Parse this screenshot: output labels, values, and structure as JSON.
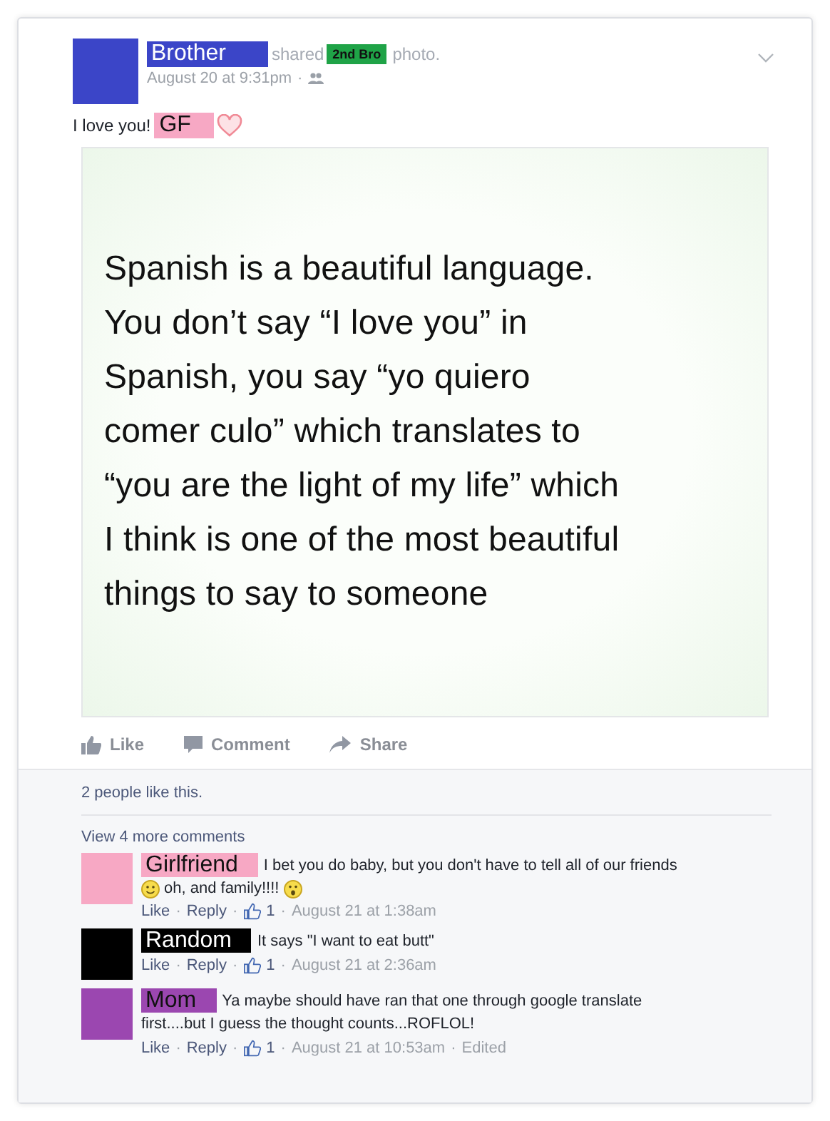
{
  "separator": "·",
  "post": {
    "author": {
      "name": "Brother",
      "color": "#3b45c8"
    },
    "shared_text": "shared",
    "source": {
      "name": "2nd Bro",
      "color": "#1fa347"
    },
    "object_text": "photo.",
    "time": "August 20 at 9:31pm",
    "message": "I love you!",
    "tag": {
      "name": "GF",
      "color": "#f7a8c4"
    },
    "image_lines": [
      "Spanish is a beautiful language.",
      "You don’t say “I love you” in",
      "Spanish, you say “yo quiero",
      "comer culo” which translates to",
      "“you are the light of my life” which",
      "I think is one of the most beautiful",
      "things to say to someone"
    ]
  },
  "actions": [
    "Like",
    "Comment",
    "Share"
  ],
  "likes_text": "2 people like this.",
  "view_more": "View 4 more comments",
  "comments": [
    {
      "name": "Girlfriend",
      "color": "#f7a8c4",
      "lines": [
        [
          {
            "kind": "text",
            "text": "I bet you do baby, but you don't have to tell all of our friends"
          }
        ],
        [
          {
            "kind": "smile"
          },
          {
            "kind": "text",
            "text": "oh, and family!!!!"
          },
          {
            "kind": "gasp"
          }
        ]
      ],
      "like": "Like",
      "reply": "Reply",
      "count": "1",
      "time": "August 21 at 1:38am"
    },
    {
      "name": "Random",
      "color": "#000000",
      "lines": [
        [
          {
            "kind": "text",
            "text": "It says \"I want to eat butt\""
          }
        ]
      ],
      "like": "Like",
      "reply": "Reply",
      "count": "1",
      "time": "August 21 at 2:36am"
    },
    {
      "name": "Mom",
      "color": "#9b47b0",
      "lines": [
        [
          {
            "kind": "text",
            "text": "Ya maybe should have ran that one through google translate"
          }
        ],
        [
          {
            "kind": "text",
            "text": "first....but I guess the thought counts...ROFLOL!"
          }
        ]
      ],
      "like": "Like",
      "reply": "Reply",
      "count": "1",
      "time": "August 21 at 10:53am",
      "edited": "Edited"
    }
  ]
}
